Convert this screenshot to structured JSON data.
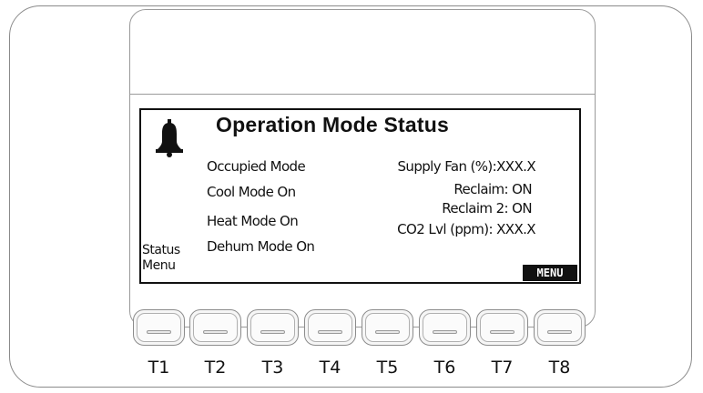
{
  "screen": {
    "title": "Operation Mode Status",
    "left_items": [
      "Occupied Mode",
      "Cool Mode On",
      "Heat Mode On",
      "Dehum Mode On"
    ],
    "right_items": [
      "Supply Fan (%):XXX.X",
      "Reclaim: ON",
      "Reclaim 2: ON",
      "CO2 Lvl (ppm): XXX.X"
    ],
    "status_menu": [
      "Status",
      "Menu"
    ],
    "menu_button": "MENU",
    "alarm_icon": "bell-icon"
  },
  "soft_keys": [
    "T1",
    "T2",
    "T3",
    "T4",
    "T5",
    "T6",
    "T7",
    "T8"
  ]
}
